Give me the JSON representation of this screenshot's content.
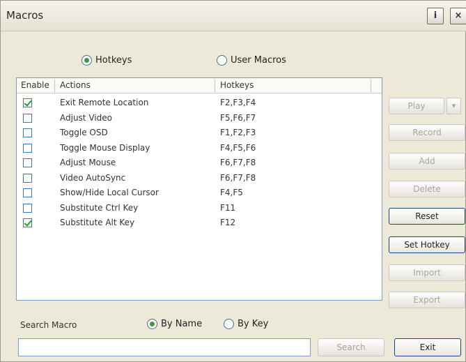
{
  "window": {
    "title": "Macros",
    "help_label": "i",
    "close_label": "×"
  },
  "mode": {
    "hotkeys_label": "Hotkeys",
    "user_macros_label": "User Macros",
    "selected": "hotkeys"
  },
  "list": {
    "headers": {
      "enable": "Enable",
      "action": "Actions",
      "hotkeys": "Hotkeys"
    },
    "rows": [
      {
        "enabled": true,
        "action": "Exit Remote Location",
        "hotkeys": "F2,F3,F4"
      },
      {
        "enabled": false,
        "action": "Adjust Video",
        "hotkeys": "F5,F6,F7"
      },
      {
        "enabled": false,
        "action": "Toggle OSD",
        "hotkeys": "F1,F2,F3"
      },
      {
        "enabled": false,
        "action": "Toggle Mouse Display",
        "hotkeys": "F4,F5,F6"
      },
      {
        "enabled": false,
        "action": "Adjust Mouse",
        "hotkeys": "F6,F7,F8"
      },
      {
        "enabled": false,
        "action": "Video AutoSync",
        "hotkeys": "F6,F7,F8"
      },
      {
        "enabled": false,
        "action": "Show/Hide Local Cursor",
        "hotkeys": "F4,F5"
      },
      {
        "enabled": false,
        "action": "Substitute Ctrl Key",
        "hotkeys": "F11"
      },
      {
        "enabled": true,
        "action": "Substitute Alt Key",
        "hotkeys": "F12"
      }
    ]
  },
  "buttons": {
    "play": "Play",
    "play_arrow": "▾",
    "record": "Record",
    "add": "Add",
    "delete": "Delete",
    "reset": "Reset",
    "set_hotkey": "Set Hotkey",
    "import": "Import",
    "export": "Export"
  },
  "search": {
    "label": "Search Macro",
    "by_name_label": "By Name",
    "by_key_label": "By Key",
    "selected": "by_name",
    "value": "",
    "button_label": "Search"
  },
  "footer": {
    "exit_label": "Exit"
  }
}
